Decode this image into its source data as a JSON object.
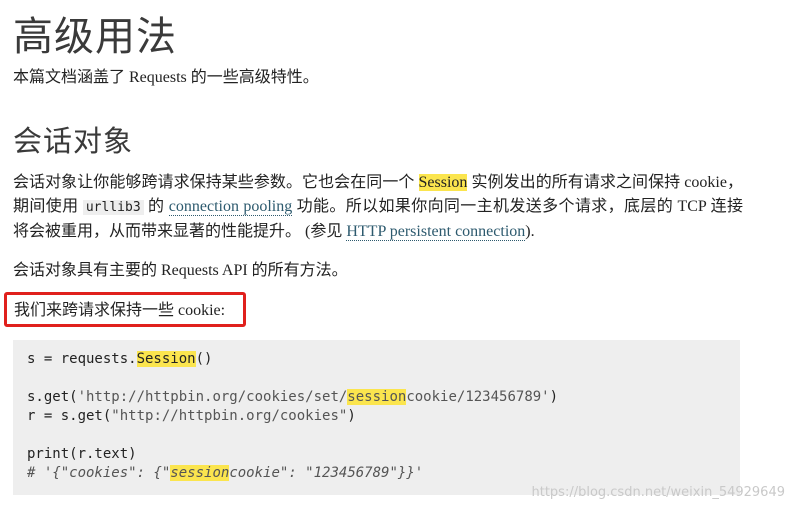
{
  "page_title": "高级用法",
  "intro": {
    "before": "本篇文档涵盖了 Requests 的一些高级特性。"
  },
  "section_title": "会话对象",
  "desc": {
    "t1": "会话对象让你能够跨请求保持某些参数。它也会在同一个 ",
    "hl": "Session",
    "t2": " 实例发出的所有请求之间保持 cookie， 期间使用 ",
    "code": "urllib3",
    "t3": " 的 ",
    "link1": "connection pooling",
    "t4": " 功能。所以如果你向同一主机发送多个请求，底层的 TCP 连接将会被重用，从而带来显著的性能提升。 (参见 ",
    "link2": "HTTP persistent connection",
    "t5": ")."
  },
  "api_text": "会话对象具有主要的 Requests API 的所有方法。",
  "callout_text": "我们来跨请求保持一些 cookie:",
  "code": {
    "l1a": "s = requests.",
    "l1hl": "Session",
    "l1b": "()",
    "l2a": "s.get(",
    "l2s1": "'http://httpbin.org/cookies/set/",
    "l2hl": "session",
    "l2s2": "cookie/123456789'",
    "l2b": ")",
    "l3a": "r = s.get(",
    "l3s": "\"http://httpbin.org/cookies\"",
    "l3b": ")",
    "l4": "print(r.text)",
    "l5a": "# '{\"cookies\": {\"",
    "l5hl": "session",
    "l5b": "cookie\": \"123456789\"}}'"
  },
  "watermark": "https://blog.csdn.net/weixin_54929649",
  "colors": {
    "highlight": "#fbe54e",
    "callout_border": "#e0201c",
    "code_bg": "#eeeeee"
  }
}
